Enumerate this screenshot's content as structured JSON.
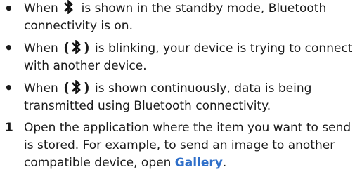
{
  "bullets": [
    {
      "marker": "•",
      "before": "When",
      "icon": "bluetooth-icon",
      "icon_style": "plain",
      "after": "is shown in the standby mode, Bluetooth connectivity is on."
    },
    {
      "marker": "•",
      "before": "When",
      "icon": "bluetooth-connecting-icon",
      "icon_style": "parenthesized",
      "after": "is blinking, your device is trying to connect with another device."
    },
    {
      "marker": "•",
      "before": "When",
      "icon": "bluetooth-connecting-icon",
      "icon_style": "parenthesized",
      "after": "is shown continuously, data is being transmitted using Bluetooth connectivity."
    }
  ],
  "steps": [
    {
      "number": "1",
      "text": "Open the application where the item you want to send is stored. For example, to send an image to another compatible device, open",
      "link": "Gallery",
      "end": "."
    }
  ],
  "colors": {
    "text": "#1a1a1a",
    "link": "#2f6fc9"
  }
}
